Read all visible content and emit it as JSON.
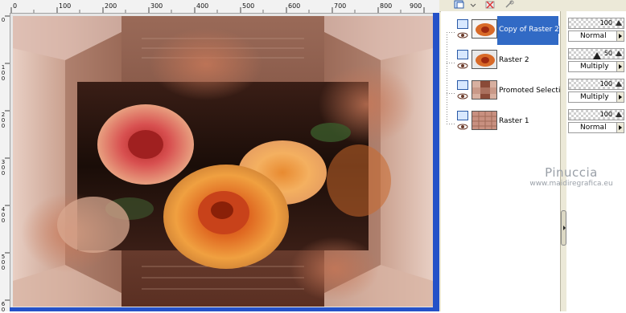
{
  "ruler": {
    "top_labels": [
      "0",
      "100",
      "200",
      "300",
      "400",
      "500",
      "600",
      "700",
      "800",
      "900"
    ],
    "left_labels": [
      "0",
      "1 0 0",
      "2 0 0",
      "3 0 0",
      "4 0 0",
      "5 0 0",
      "6 0"
    ]
  },
  "layers": [
    {
      "name": "Copy of Raster 2",
      "selected": true,
      "thumb": "rose-thumb"
    },
    {
      "name": "Raster 2",
      "selected": false,
      "thumb": "rose-thumb"
    },
    {
      "name": "Promoted Selectio",
      "selected": false,
      "thumb": "frame-thumb"
    },
    {
      "name": "Raster 1",
      "selected": false,
      "thumb": "pattern-thumb"
    }
  ],
  "layer_props": [
    {
      "opacity": "100",
      "blend": "Normal"
    },
    {
      "opacity": "50",
      "blend": "Multiply"
    },
    {
      "opacity": "100",
      "blend": "Multiply"
    },
    {
      "opacity": "100",
      "blend": "Normal"
    }
  ],
  "watermark": {
    "name": "Pinuccia",
    "site": "www.maidiregrafica.eu"
  },
  "colors": {
    "selection": "#316ac5",
    "panel_bg": "#ece9d8",
    "scrollbar": "#2451c8"
  },
  "icons": [
    "layer-icon",
    "eye-icon",
    "new-layer-icon",
    "delete-layer-icon",
    "link-icon"
  ]
}
